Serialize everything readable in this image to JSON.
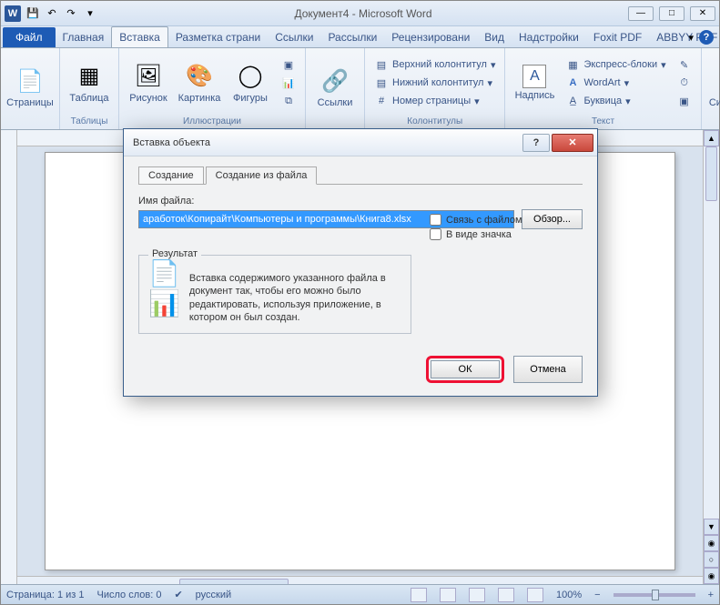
{
  "window": {
    "title": "Документ4 - Microsoft Word",
    "app_letter": "W"
  },
  "tabs": {
    "file": "Файл",
    "items": [
      "Главная",
      "Вставка",
      "Разметка страни",
      "Ссылки",
      "Рассылки",
      "Рецензировани",
      "Вид",
      "Надстройки",
      "Foxit PDF",
      "ABBYY PDF Trans"
    ],
    "active_index": 1
  },
  "ribbon": {
    "groups": {
      "pages": {
        "label": "",
        "btn": "Страницы"
      },
      "tables": {
        "label": "Таблицы",
        "btn": "Таблица"
      },
      "illus": {
        "label": "Иллюстрации",
        "btns": [
          "Рисунок",
          "Картинка",
          "Фигуры"
        ]
      },
      "links": {
        "label": "",
        "btn": "Ссылки"
      },
      "headfoot": {
        "label": "Колонтитулы",
        "items": [
          "Верхний колонтитул",
          "Нижний колонтитул",
          "Номер страницы"
        ]
      },
      "text": {
        "label": "Текст",
        "big": "Надпись",
        "items": [
          "Экспресс-блоки",
          "WordArt",
          "Буквица"
        ]
      },
      "symbols": {
        "label": "",
        "btn": "Символы"
      }
    }
  },
  "dialog": {
    "title": "Вставка объекта",
    "tabs": {
      "create": "Создание",
      "from_file": "Создание из файла"
    },
    "file_label": "Имя файла:",
    "file_value": "аработок\\Копирайт\\Компьютеры и программы\\Книга8.xlsx",
    "browse": "Обзор...",
    "link_checkbox": "Связь с файлом",
    "icon_checkbox": "В виде значка",
    "result_label": "Результат",
    "result_text": "Вставка содержимого указанного файла в документ так, чтобы его можно было редактировать, используя приложение, в котором он был создан.",
    "ok": "ОК",
    "cancel": "Отмена",
    "help_btn": "?"
  },
  "status": {
    "page": "Страница: 1 из 1",
    "words": "Число слов: 0",
    "lang": "русский",
    "zoom": "100%"
  }
}
